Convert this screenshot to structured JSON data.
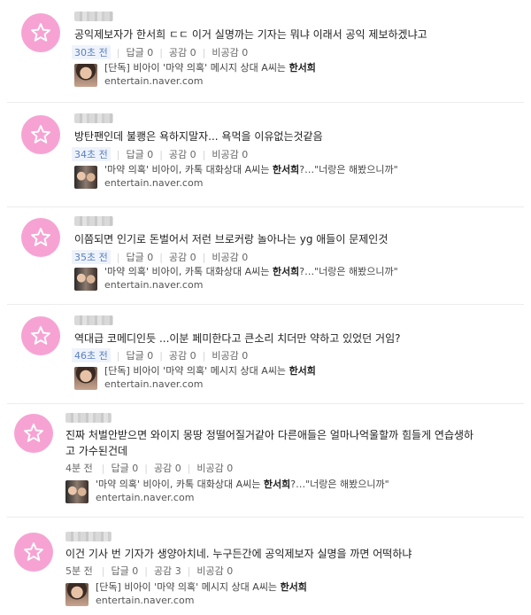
{
  "comments": [
    {
      "text": "공익제보자가 한서희 ㄷㄷ 이거 실명까는 기자는 뭐냐 이래서 공익 제보하겠냐고",
      "time": "30초 전",
      "reply_label": "답글",
      "reply_count": "0",
      "like_label": "공감",
      "like_count": "0",
      "dislike_label": "비공감",
      "dislike_count": "0",
      "article": {
        "title_prefix": "[단독] 비아이 '마약 의혹' 메시지 상대 A씨는 ",
        "title_bold": "한서희",
        "title_suffix": "",
        "source": "entertain.naver.com"
      }
    },
    {
      "text": "방탄팬인데 불쾡은 욕하지말자... 욕먹을 이유없는것같음",
      "time": "34초 전",
      "reply_label": "답글",
      "reply_count": "0",
      "like_label": "공감",
      "like_count": "0",
      "dislike_label": "비공감",
      "dislike_count": "0",
      "article": {
        "title_prefix": "'마약 의혹' 비아이, 카톡 대화상대 A씨는 ",
        "title_bold": "한서희",
        "title_suffix": "?…\"너랑은 해봤으니까\"",
        "source": "entertain.naver.com"
      }
    },
    {
      "text": "이쯤되면 인기로 돈벌어서 저런 브로커랑 놀아나는 yg 애들이 문제인것",
      "time": "35초 전",
      "reply_label": "답글",
      "reply_count": "0",
      "like_label": "공감",
      "like_count": "0",
      "dislike_label": "비공감",
      "dislike_count": "0",
      "article": {
        "title_prefix": "'마약 의혹' 비아이, 카톡 대화상대 A씨는 ",
        "title_bold": "한서희",
        "title_suffix": "?…\"너랑은 해봤으니까\"",
        "source": "entertain.naver.com"
      }
    },
    {
      "text": "역대급 코메디인듯 ...이분 페미한다고 큰소리 치더만 약하고 있었던 거임?",
      "time": "46초 전",
      "reply_label": "답글",
      "reply_count": "0",
      "like_label": "공감",
      "like_count": "0",
      "dislike_label": "비공감",
      "dislike_count": "0",
      "article": {
        "title_prefix": "[단독] 비아이 '마약 의혹' 메시지 상대 A씨는 ",
        "title_bold": "한서희",
        "title_suffix": "",
        "source": "entertain.naver.com"
      }
    },
    {
      "text": "진짜 처벌안받으면 와이지 몽땅 정떨어질거같아 다른애들은 얼마나억울할까 힘들게 연습생하고 가수된건데",
      "time": "4분 전",
      "reply_label": "답글",
      "reply_count": "0",
      "like_label": "공감",
      "like_count": "0",
      "dislike_label": "비공감",
      "dislike_count": "0",
      "article": {
        "title_prefix": "'마약 의혹' 비아이, 카톡 대화상대 A씨는 ",
        "title_bold": "한서희",
        "title_suffix": "?…\"너랑은 해봤으니까\"",
        "source": "entertain.naver.com"
      }
    },
    {
      "text": "이건 기사 번 기자가 생양아치네. 누구든간에 공익제보자 실명을 까면 어떡하냐",
      "time": "5분 전",
      "reply_label": "답글",
      "reply_count": "0",
      "like_label": "공감",
      "like_count": "3",
      "dislike_label": "비공감",
      "dislike_count": "0",
      "article": {
        "title_prefix": "[단독] 비아이 '마약 의혹' 메시지 상대 A씨는 ",
        "title_bold": "한서희",
        "title_suffix": "",
        "source": "entertain.naver.com"
      }
    }
  ],
  "colors": {
    "avatar": "#f6a3d3",
    "time": "#5a7fbf",
    "separator": "#ececec"
  },
  "icons": {
    "avatar": "star-icon"
  }
}
